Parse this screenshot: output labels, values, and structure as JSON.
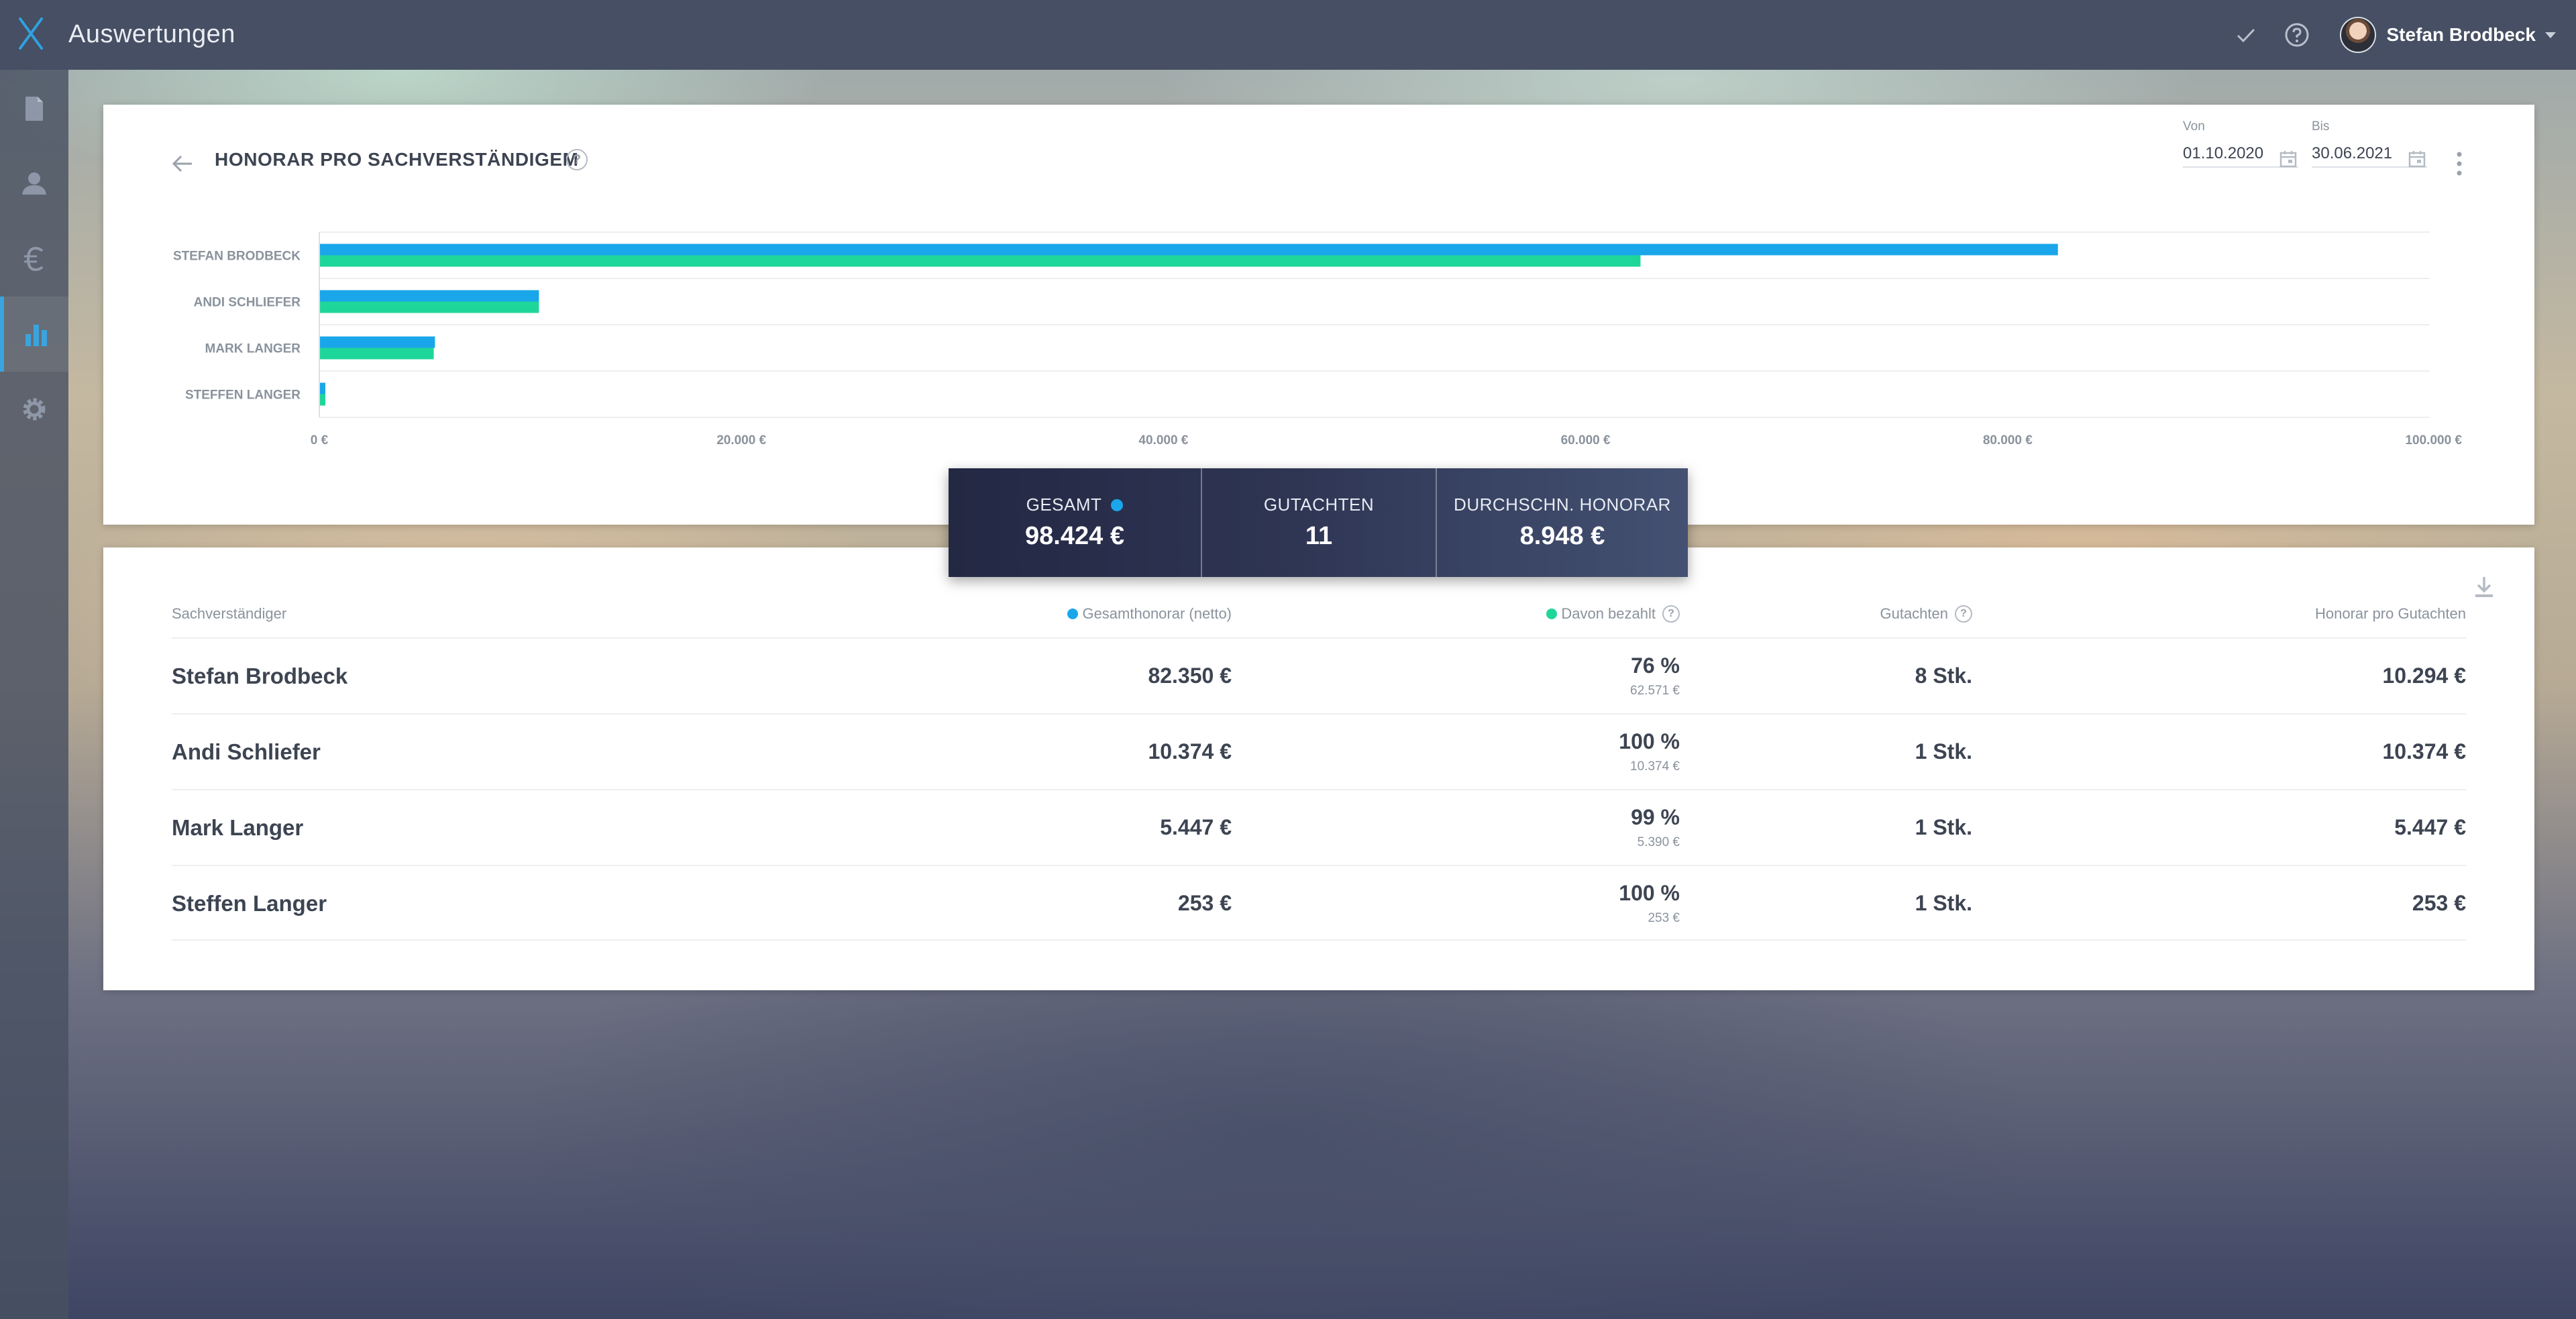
{
  "app": {
    "title": "Auswertungen"
  },
  "user": {
    "name": "Stefan Brodbeck"
  },
  "colors": {
    "total": "#19a6ea",
    "paid": "#1fd69a",
    "sidebar_active": "#3aa4df"
  },
  "sidebar": {
    "items": [
      {
        "icon": "document-icon"
      },
      {
        "icon": "contacts-icon"
      },
      {
        "icon": "euro-icon"
      },
      {
        "icon": "bar-chart-icon",
        "active": true
      },
      {
        "icon": "gear-icon"
      }
    ]
  },
  "report": {
    "title": "HONORAR PRO SACHVERSTÄNDIGEM",
    "date_from_label": "Von",
    "date_from": "01.10.2020",
    "date_to_label": "Bis",
    "date_to": "30.06.2021"
  },
  "chart_data": {
    "type": "bar",
    "orientation": "horizontal",
    "categories": [
      "STEFAN BRODBECK",
      "ANDI SCHLIEFER",
      "MARK LANGER",
      "STEFFEN LANGER"
    ],
    "series": [
      {
        "name": "Gesamthonorar (netto)",
        "values": [
          82350,
          10374,
          5447,
          253
        ]
      },
      {
        "name": "Davon bezahlt",
        "values": [
          62571,
          10374,
          5390,
          253
        ]
      }
    ],
    "xlim": [
      0,
      100000
    ],
    "xticks": [
      0,
      20000,
      40000,
      60000,
      80000,
      100000
    ],
    "xtick_labels": [
      "0 €",
      "20.000 €",
      "40.000 €",
      "60.000 €",
      "80.000 €",
      "100.000 €"
    ],
    "grid": true
  },
  "summary": [
    {
      "label": "GESAMT",
      "value": "98.424 €"
    },
    {
      "label": "GUTACHTEN",
      "value": "11"
    },
    {
      "label": "DURCHSCHN. HONORAR",
      "value": "8.948 €"
    }
  ],
  "table": {
    "headers": {
      "name": "Sachverständiger",
      "total": "Gesamthonorar (netto)",
      "paid": "Davon bezahlt",
      "count": "Gutachten",
      "per": "Honorar pro Gutachten"
    },
    "rows": [
      {
        "name": "Stefan Brodbeck",
        "total": "82.350 €",
        "paid_pct": "76 %",
        "paid_amount": "62.571 €",
        "count": "8 Stk.",
        "per": "10.294 €"
      },
      {
        "name": "Andi Schliefer",
        "total": "10.374 €",
        "paid_pct": "100 %",
        "paid_amount": "10.374 €",
        "count": "1 Stk.",
        "per": "10.374 €"
      },
      {
        "name": "Mark Langer",
        "total": "5.447 €",
        "paid_pct": "99 %",
        "paid_amount": "5.390 €",
        "count": "1 Stk.",
        "per": "5.447 €"
      },
      {
        "name": "Steffen Langer",
        "total": "253 €",
        "paid_pct": "100 %",
        "paid_amount": "253 €",
        "count": "1 Stk.",
        "per": "253 €"
      }
    ]
  }
}
